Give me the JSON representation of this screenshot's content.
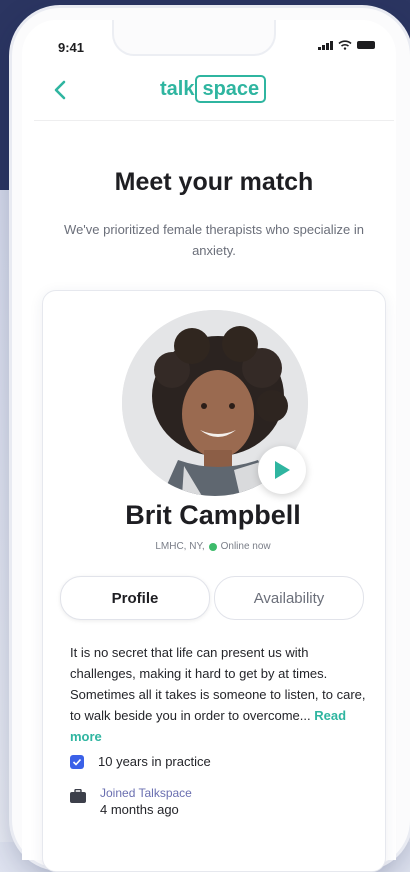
{
  "status_bar": {
    "time": "9:41"
  },
  "nav": {
    "logo_left": "talk",
    "logo_boxed": "space"
  },
  "header": {
    "title": "Meet your match",
    "subtitle": "We've prioritized female therapists who specialize in anxiety."
  },
  "therapist": {
    "name": "Brit Campbell",
    "credentials": "LMHC, NY,",
    "online_status": "Online now",
    "tabs": [
      "Profile",
      "Availability"
    ],
    "selected_tab": "Profile",
    "bio": "It is no secret that life can present us with challenges, making it hard to get by at times. Sometimes all it takes is someone to listen, to care, to walk beside you in order to overcome...",
    "read_more": "Read more",
    "experience": "10 years in practice",
    "joined_label": "Joined Talkspace",
    "joined_value": "4 months ago"
  },
  "colors": {
    "brand": "#2fb5a0",
    "online": "#3dbb6b",
    "checkbox": "#3b61e8",
    "background_top": "#2b3561"
  },
  "icons": [
    "back-chevron-icon",
    "signal-icon",
    "wifi-icon",
    "battery-icon",
    "play-icon",
    "checkbox-icon",
    "suitcase-icon"
  ]
}
